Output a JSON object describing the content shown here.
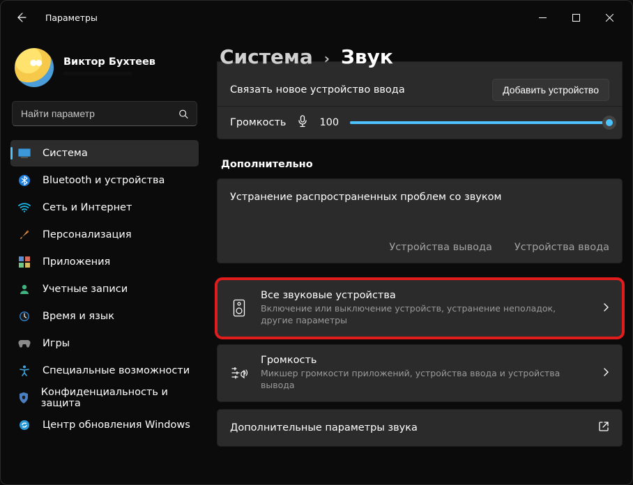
{
  "window": {
    "app_title": "Параметры"
  },
  "user": {
    "name": "Виктор Бухтеев",
    "sub": "························"
  },
  "search": {
    "placeholder": "Найти параметр"
  },
  "nav": {
    "items": [
      {
        "label": "Система",
        "selected": true
      },
      {
        "label": "Bluetooth и устройства"
      },
      {
        "label": "Сеть и Интернет"
      },
      {
        "label": "Персонализация"
      },
      {
        "label": "Приложения"
      },
      {
        "label": "Учетные записи"
      },
      {
        "label": "Время и язык"
      },
      {
        "label": "Игры"
      },
      {
        "label": "Специальные возможности"
      },
      {
        "label": "Конфиденциальность и защита"
      },
      {
        "label": "Центр обновления Windows"
      }
    ]
  },
  "breadcrumb": {
    "parent": "Система",
    "current": "Звук"
  },
  "pair": {
    "label": "Связать новое устройство ввода",
    "button": "Добавить устройство"
  },
  "volume_in": {
    "label": "Громкость",
    "value": "100",
    "percent": 100
  },
  "section_more": "Дополнительно",
  "trouble": {
    "title": "Устранение распространенных проблем со звуком",
    "link_out": "Устройства вывода",
    "link_in": "Устройства ввода"
  },
  "rows": {
    "all_devices": {
      "title": "Все звуковые устройства",
      "sub": "Включение или выключение устройств, устранение неполадок, другие параметры"
    },
    "mixer": {
      "title": "Громкость",
      "sub": "Микшер громкости приложений, устройства ввода и устройства вывода"
    },
    "more_sound": {
      "title": "Дополнительные параметры звука"
    }
  }
}
